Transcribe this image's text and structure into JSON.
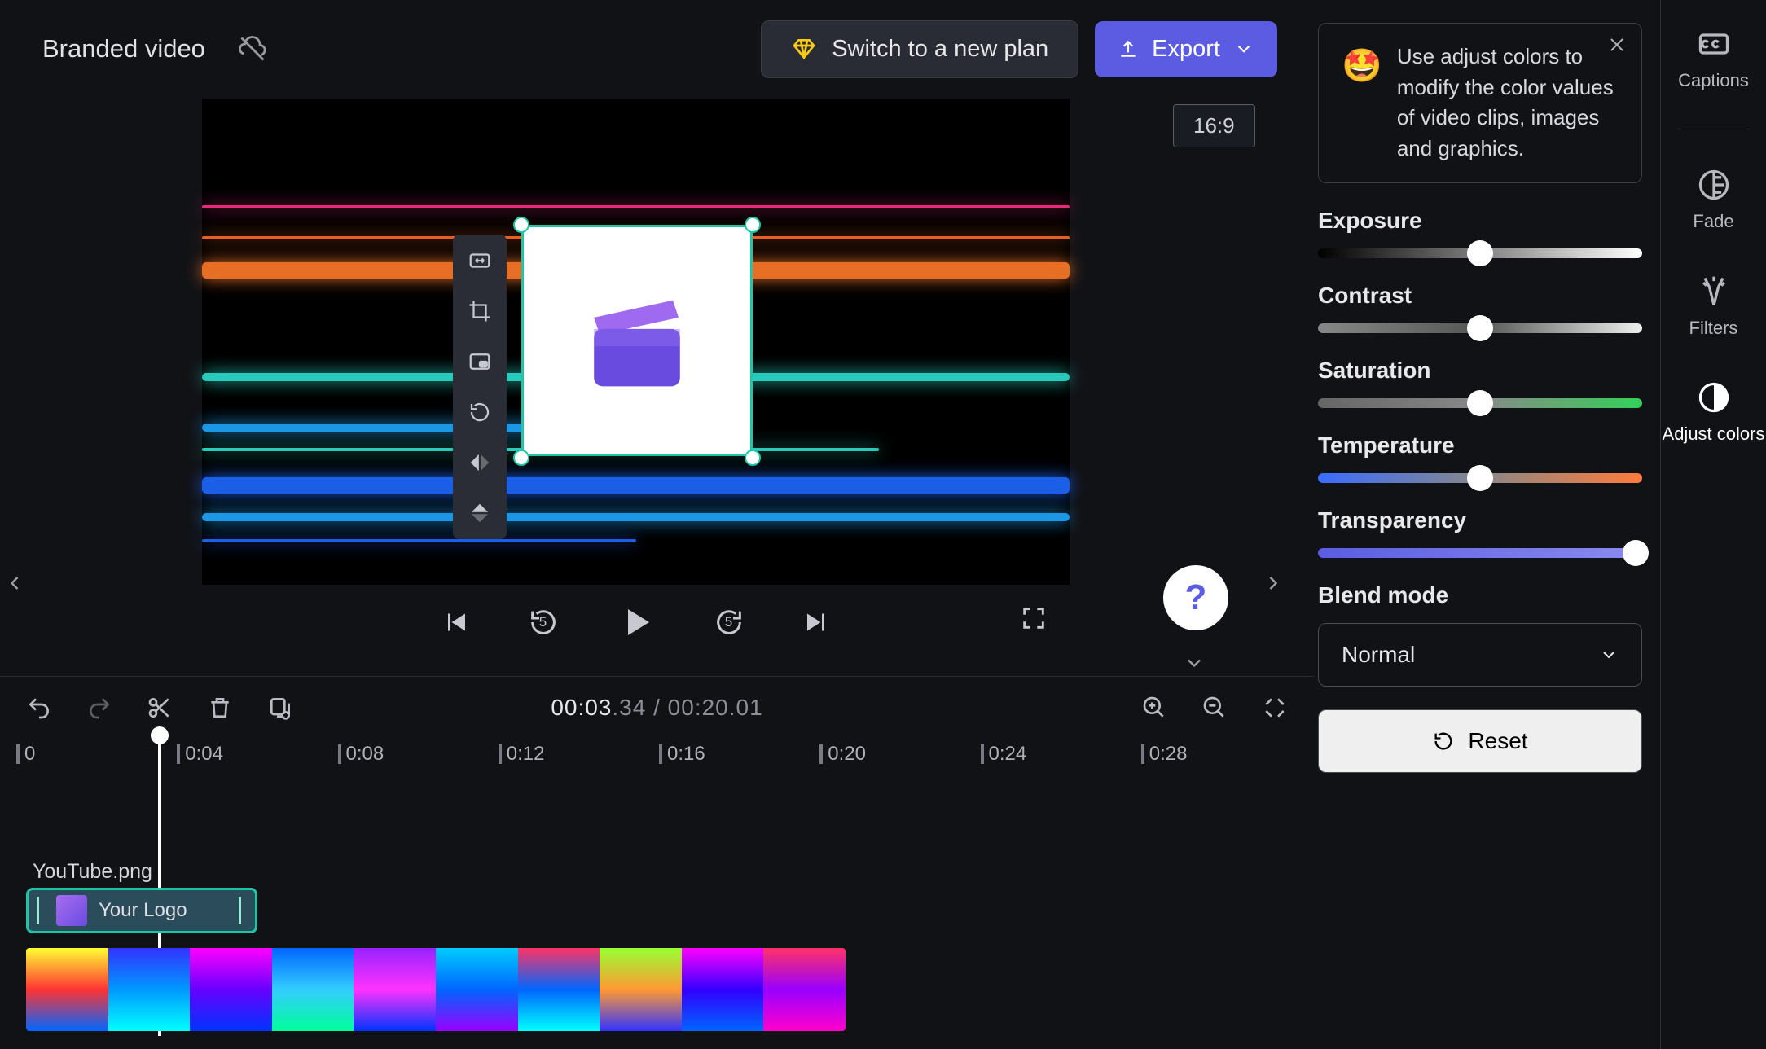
{
  "project": {
    "title": "Branded video"
  },
  "header": {
    "upgrade_label": "Switch to a new plan",
    "export_label": "Export"
  },
  "preview": {
    "aspect_label": "16:9"
  },
  "playback": {
    "skip_back_seconds": "5",
    "skip_fwd_seconds": "5"
  },
  "timeline": {
    "current_whole": "00:03",
    "current_frac": ".34",
    "total_whole": "00:20",
    "total_frac": ".01",
    "ruler": [
      "0",
      "0:04",
      "0:08",
      "0:12",
      "0:16",
      "0:20",
      "0:24",
      "0:28"
    ],
    "clip_tooltip": "YouTube.png",
    "logo_clip_label": "Your Logo"
  },
  "panel": {
    "tip_text": "Use adjust colors to modify the color values of video clips, images and graphics.",
    "exposure": {
      "title": "Exposure",
      "value": 50
    },
    "contrast": {
      "title": "Contrast",
      "value": 50
    },
    "saturation": {
      "title": "Saturation",
      "value": 50
    },
    "temperature": {
      "title": "Temperature",
      "value": 50
    },
    "transparency": {
      "title": "Transparency",
      "value": 100
    },
    "blend_title": "Blend mode",
    "blend_value": "Normal",
    "reset_label": "Reset"
  },
  "sidebar": {
    "captions": "Captions",
    "fade": "Fade",
    "filters": "Filters",
    "adjust": "Adjust colors"
  }
}
